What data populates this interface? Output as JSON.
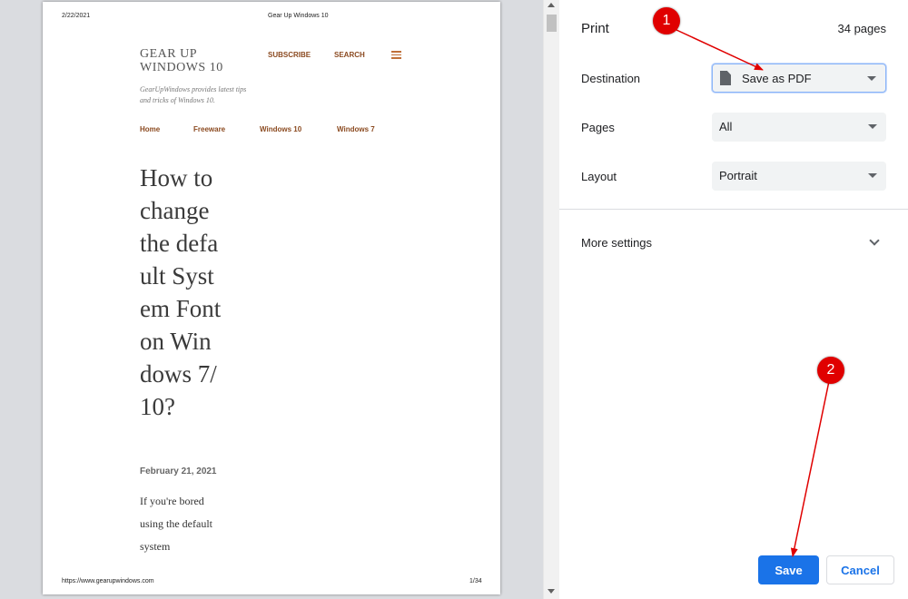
{
  "preview": {
    "header_date": "2/22/2021",
    "header_title": "Gear Up Windows 10",
    "footer_url": "https://www.gearupwindows.com",
    "footer_page": "1/34",
    "site": {
      "title": "GEAR UP WINDOWS 10",
      "subscribe": "SUBSCRIBE",
      "search": "SEARCH",
      "tagline": "GearUpWindows provides latest tips and tricks of Windows 10.",
      "nav": [
        "Home",
        "Freeware",
        "Windows 10",
        "Windows 7"
      ]
    },
    "article": {
      "title": "How to change the default System Font on Windows 7/10?",
      "date": "February 21, 2021",
      "body": "If you're bored using the default system"
    }
  },
  "settings": {
    "title": "Print",
    "page_count": "34 pages",
    "destination": {
      "label": "Destination",
      "value": "Save as PDF",
      "icon": "document-icon"
    },
    "pages": {
      "label": "Pages",
      "value": "All"
    },
    "layout": {
      "label": "Layout",
      "value": "Portrait"
    },
    "more_settings": "More settings",
    "save": "Save",
    "cancel": "Cancel"
  },
  "annotations": {
    "badge_1": "1",
    "badge_2": "2",
    "color": "#e00000"
  },
  "colors": {
    "accent": "#1a73e8",
    "site_link": "#8b4a20",
    "preview_bg": "#dadce0"
  }
}
